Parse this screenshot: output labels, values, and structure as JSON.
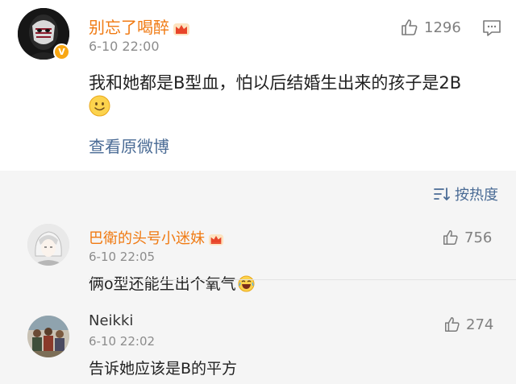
{
  "main_post": {
    "username": "别忘了喝醉",
    "time": "6-10 22:00",
    "likes": "1296",
    "verified_badge": "V",
    "text": "我和她都是B型血，怕以后结婚生出来的孩子是2B",
    "view_original": "查看原微博",
    "icons": [
      "thumbs-up-icon",
      "comment-icon",
      "smiley-emoji",
      "crown-icon"
    ]
  },
  "sort": {
    "label": "按热度",
    "icon": "sort-icon"
  },
  "comments": [
    {
      "username": "巴衛的头号小迷妹",
      "time": "6-10 22:05",
      "likes": "756",
      "text": "俩o型还能生出个氧气"
    },
    {
      "username": "Neikki",
      "time": "6-10 22:02",
      "likes": "274",
      "text": "告诉她应该是B的平方"
    }
  ],
  "colors": {
    "username_orange": "#f07a12",
    "link_blue": "#4a6b95",
    "meta_gray": "#8c8c8c",
    "comments_bg": "#f5f5f5"
  }
}
